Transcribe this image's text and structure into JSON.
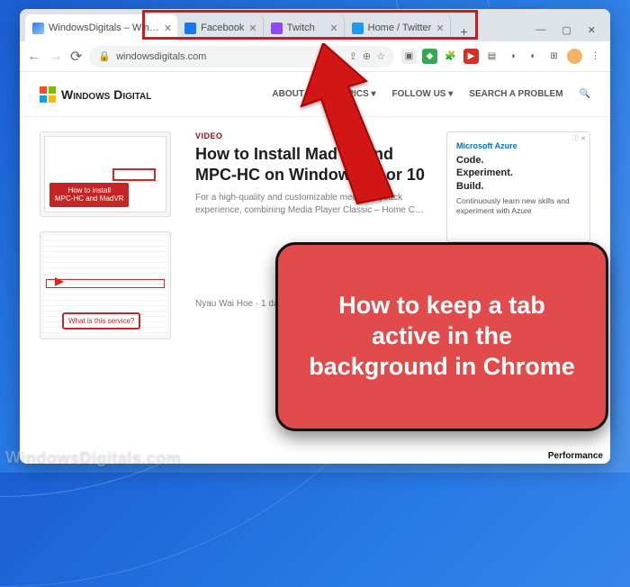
{
  "tabs": [
    {
      "icon_color": "linear-gradient(135deg,#2b7de9,#8ec5ff)",
      "label": "WindowsDigitals – Win…"
    },
    {
      "icon_color": "#1877f2",
      "label": "Facebook"
    },
    {
      "icon_color": "#9146ff",
      "label": "Twitch"
    },
    {
      "icon_color": "#1d9bf0",
      "label": "Home / Twitter"
    }
  ],
  "window_controls": {
    "min": "—",
    "max": "▢",
    "close": "✕"
  },
  "addr": {
    "lock": "🔒",
    "url": "windowsdigitals.com"
  },
  "nav": {
    "about": "ABOUT US",
    "topics": "TOPICS ▾",
    "follow": "FOLLOW US ▾",
    "search": "SEARCH A PROBLEM",
    "search_icon": "🔍"
  },
  "logo_text": "Windows Digital",
  "article": {
    "cat": "VIDEO",
    "title": "How to Install MadVR and MPC-HC on Windows 11 or 10",
    "excerpt": "For a high-quality and customizable media playback experience, combining Media Player Classic – Home C…",
    "author_line": "Nyau Wai Hoe · 1 day ago"
  },
  "thumb1": "How to install\nMPC-HC and MadVR",
  "thumb2": "What is this service?",
  "ad": {
    "brand": "Microsoft Azure",
    "head": "Code.\nExperiment.\nBuild.",
    "text": "Continuously learn new skills and experiment with Azure",
    "info": "ⓘ ✕"
  },
  "perf": "Performance",
  "callout": "How to keep a tab active in the background in Chrome",
  "watermark": "WindowsDigitals.com"
}
